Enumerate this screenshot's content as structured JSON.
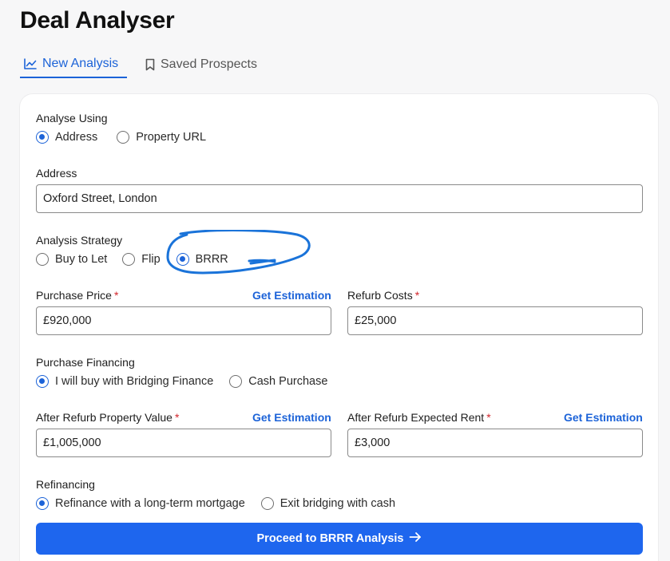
{
  "page": {
    "title": "Deal Analyser"
  },
  "tabs": [
    {
      "label": "New Analysis",
      "icon": "line-chart-icon",
      "active": true
    },
    {
      "label": "Saved Prospects",
      "icon": "bookmark-icon",
      "active": false
    }
  ],
  "form": {
    "analyse_using": {
      "label": "Analyse Using",
      "options": [
        "Address",
        "Property URL"
      ],
      "selected": "Address"
    },
    "address": {
      "label": "Address",
      "value": "Oxford Street, London"
    },
    "analysis_strategy": {
      "label": "Analysis Strategy",
      "options": [
        "Buy to Let",
        "Flip",
        "BRRR"
      ],
      "selected": "BRRR"
    },
    "purchase_price": {
      "label": "Purchase Price",
      "required_mark": "*",
      "value": "£920,000",
      "link": "Get Estimation"
    },
    "refurb_costs": {
      "label": "Refurb Costs",
      "required_mark": "*",
      "value": "£25,000"
    },
    "purchase_financing": {
      "label": "Purchase Financing",
      "options": [
        "I will buy with Bridging Finance",
        "Cash Purchase"
      ],
      "selected": "I will buy with Bridging Finance"
    },
    "after_refurb_value": {
      "label": "After Refurb Property Value",
      "required_mark": "*",
      "value": "£1,005,000",
      "link": "Get Estimation"
    },
    "after_refurb_rent": {
      "label": "After Refurb Expected Rent",
      "required_mark": "*",
      "value": "£3,000",
      "link": "Get Estimation"
    },
    "refinancing": {
      "label": "Refinancing",
      "options": [
        "Refinance with a long-term mortgage",
        "Exit bridging with cash"
      ],
      "selected": "Refinance with a long-term mortgage"
    },
    "proceed_button": {
      "label": "Proceed to BRRR Analysis",
      "icon": "arrow-right-icon"
    }
  },
  "colors": {
    "accent": "#1c63d8",
    "button": "#1e66ee",
    "annotation": "#1a73d9",
    "required": "#d2262c"
  }
}
